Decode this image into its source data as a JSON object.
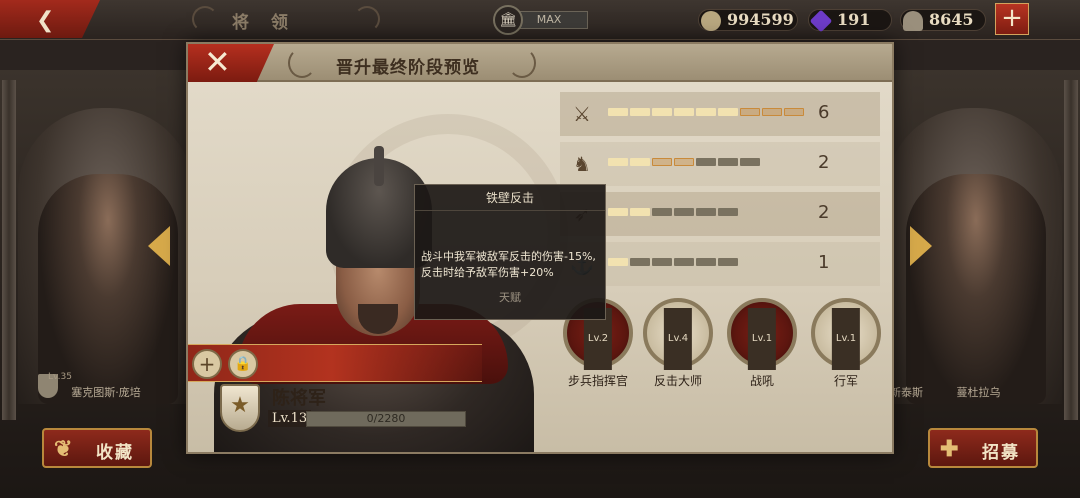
{
  "topbar": {
    "back_icon": "back-arrow-icon",
    "title": "将 领",
    "building_level": "MAX",
    "resources": [
      {
        "name": "coin",
        "value": "994599",
        "color": "#b9a880"
      },
      {
        "name": "gem",
        "value": "191",
        "color": "#6e3cc8"
      },
      {
        "name": "helmet",
        "value": "8645",
        "color": "#9a8f7c"
      }
    ],
    "add_label": "+"
  },
  "side_generals": {
    "left": {
      "name": "塞克图斯·庞培",
      "level": "Lv.35"
    },
    "right": {
      "name": "蔓杜拉乌",
      "partial_name": "新泰斯"
    }
  },
  "bottom_buttons": {
    "collect": "收藏",
    "recruit": "招募"
  },
  "modal": {
    "title": "晋升最终阶段预览",
    "close_icon": "close-icon",
    "general": {
      "name": "陈将军",
      "level": "Lv.13",
      "xp_text": "0/2280",
      "xp_fraction": 0
    },
    "stats": [
      {
        "icon": "sword-icon",
        "value": "6",
        "filled": 6,
        "preview": 3,
        "total": 9
      },
      {
        "icon": "horse-icon",
        "value": "2",
        "filled": 2,
        "preview": 2,
        "total": 7
      },
      {
        "icon": "bow-icon",
        "value": "2",
        "filled": 2,
        "preview": 0,
        "total": 6
      },
      {
        "icon": "anchor-icon",
        "value": "1",
        "filled": 1,
        "preview": 0,
        "total": 6
      }
    ],
    "skills": [
      {
        "name": "步兵指挥官",
        "level": "Lv.2",
        "icon": "crossed-swords-icon",
        "style": "dark"
      },
      {
        "name": "反击大师",
        "level": "Lv.4",
        "icon": "duel-icon",
        "style": "light"
      },
      {
        "name": "战吼",
        "level": "Lv.1",
        "icon": "warcry-icon",
        "style": "dark"
      },
      {
        "name": "行军",
        "level": "Lv.1",
        "icon": "march-icon",
        "style": "light"
      }
    ],
    "tooltip": {
      "title": "铁壁反击",
      "description_line1": "战斗中我军被敌军反击的伤害-15%,",
      "description_line2": "反击时给予敌军伤害+20%",
      "type": "天赋"
    }
  },
  "colors": {
    "accent_red": "#a52b1c",
    "gold": "#d6a94a",
    "bar_filled": "#f2e2b0",
    "bar_preview": "#c98a3a",
    "bar_empty": "#7a7260"
  }
}
